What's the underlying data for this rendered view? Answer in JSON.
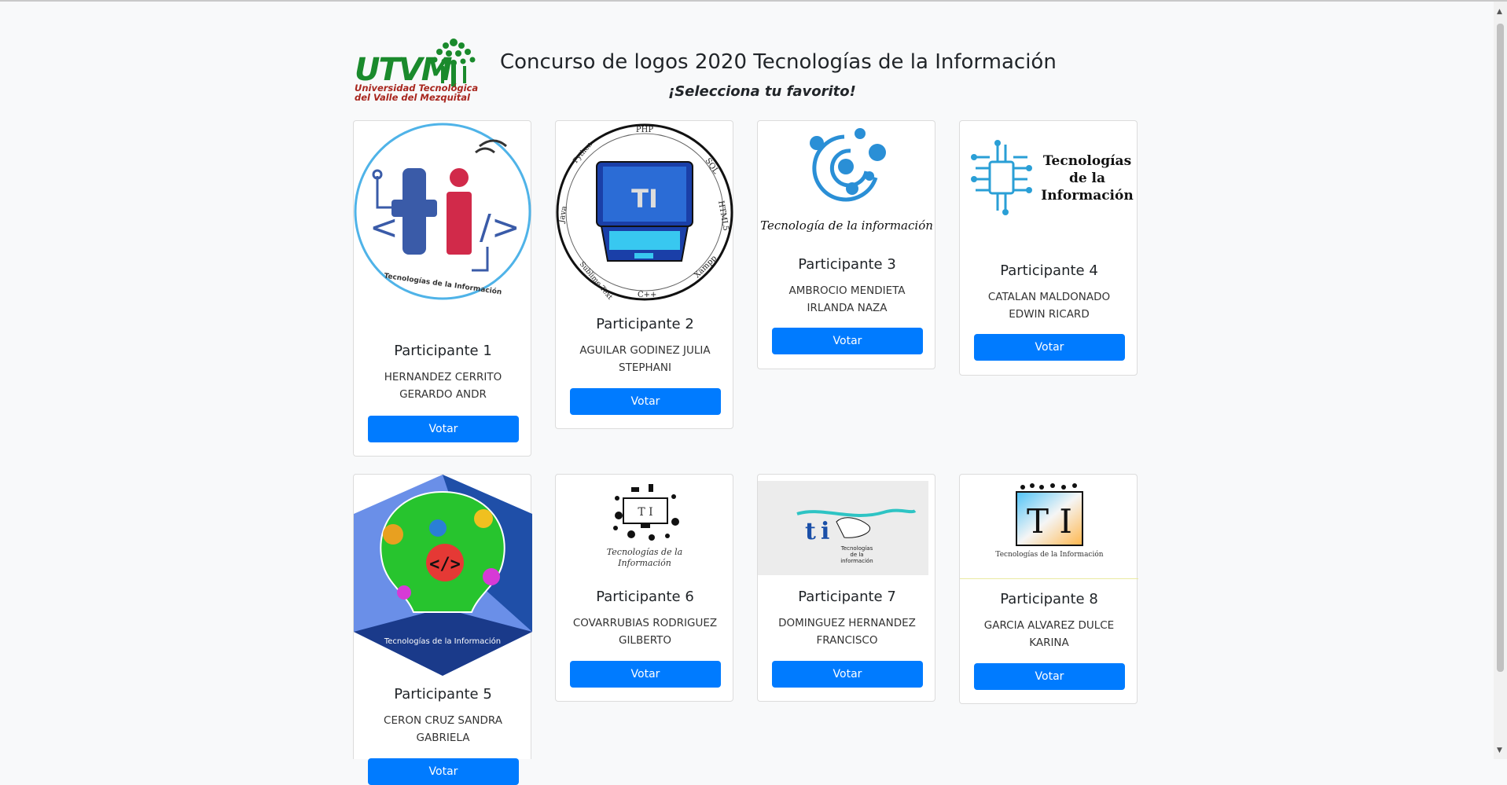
{
  "header": {
    "title": "Concurso de logos 2020 Tecnologías de la Información",
    "subtitle": "¡Selecciona tu favorito!",
    "logo_letters": "UTVM",
    "logo_line1": "Universidad Tecnológica",
    "logo_line2": "del Valle del Mezquital"
  },
  "participants": [
    {
      "title": "Participante 1",
      "name": "HERNANDEZ CERRITO GERARDO ANDR",
      "button": "Votar"
    },
    {
      "title": "Participante 2",
      "name": "AGUILAR GODINEZ JULIA STEPHANI",
      "button": "Votar"
    },
    {
      "title": "Participante 3",
      "name": "AMBROCIO MENDIETA IRLANDA NAZA",
      "button": "Votar"
    },
    {
      "title": "Participante 4",
      "name": "CATALAN MALDONADO EDWIN RICARD",
      "button": "Votar"
    },
    {
      "title": "Participante 5",
      "name": "CERON CRUZ SANDRA GABRIELA",
      "button": "Votar"
    },
    {
      "title": "Participante 6",
      "name": "COVARRUBIAS RODRIGUEZ GILBERTO",
      "button": "Votar"
    },
    {
      "title": "Participante 7",
      "name": "DOMINGUEZ HERNANDEZ FRANCISCO",
      "button": "Votar"
    },
    {
      "title": "Participante 8",
      "name": "GARCIA ALVAREZ DULCE KARINA",
      "button": "Votar"
    }
  ],
  "logo_texts": {
    "p1": "Tecnologías de la Información",
    "p2_langs": [
      "PHP",
      "SQL",
      "HTML5",
      "Xampp",
      "C++",
      "Sublime Text",
      "Java",
      "Python"
    ],
    "p2_mark": "TI",
    "p3": "Tecnología de la información",
    "p4_line1": "Tecnologías",
    "p4_line2": "de la",
    "p4_line3": "Información",
    "p5": "Tecnologías de la Información",
    "p6_mark": "T I",
    "p6_line1": "Tecnologías de la",
    "p6_line2": "Información",
    "p7_line1": "Tecnologías",
    "p7_line2": "de la",
    "p7_line3": "información",
    "p8_mark": "T I",
    "p8_sub": "Tecnologías de la Información"
  },
  "colors": {
    "button": "#007bff",
    "page_bg": "#f8f9fa",
    "utvm_green": "#1a8a2c",
    "utvm_red": "#a8261e"
  }
}
